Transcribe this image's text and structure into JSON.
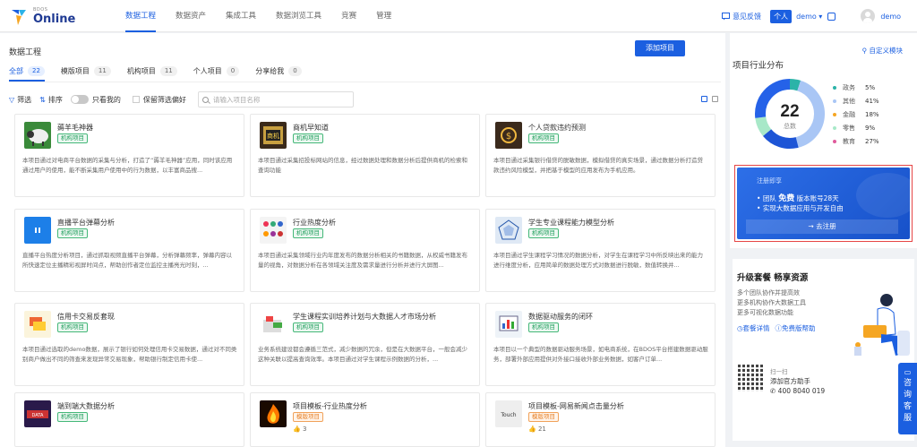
{
  "logo": {
    "small": "BDOS",
    "big": "Online"
  },
  "nav": [
    "数据工程",
    "数据资产",
    "集成工具",
    "数据浏览工具",
    "竞赛",
    "管理"
  ],
  "header": {
    "feedback": "意见反馈",
    "personal": "个人",
    "workspace": "demo ▾",
    "user": "demo"
  },
  "main": {
    "title": "数据工程",
    "add_button": "添加项目",
    "tabs": [
      {
        "label": "全部",
        "count": "22"
      },
      {
        "label": "模版项目",
        "count": "11"
      },
      {
        "label": "机构项目",
        "count": "11"
      },
      {
        "label": "个人项目",
        "count": "0"
      },
      {
        "label": "分享给我",
        "count": "0"
      }
    ],
    "filters": {
      "filter": "筛选",
      "sort": "排序",
      "only_mine": "只看我的",
      "keep": "保留筛选偏好",
      "search_placeholder": "请输入项目名称"
    }
  },
  "cards": [
    {
      "title": "薅羊毛神器",
      "tag": "机构项目",
      "desc": "本项目通过对电商平台数据的采集与分析，打造了“薅羊毛神器”应用，同时该应用通过用户的使用，能不断采集用户使用中的行为数据，以丰富商品搜..."
    },
    {
      "title": "商机早知道",
      "tag": "机构项目",
      "desc": "本项目通过采集招投标网站的信息，经过数据处理和数据分析后提供商机的检索和查询功能"
    },
    {
      "title": "个人贷款违约预测",
      "tag": "机构项目",
      "desc": "本项目通过采集银行借贷的脱敏数据，模拟借贷的真实场景，通过数据分析打造贷款违约风险模型，并把基于模型的应用发布为手机应用。"
    },
    {
      "title": "直播平台弹幕分析",
      "tag": "机构项目",
      "desc": "直播平台热度分析项目，通过抓取视频直播平台弹幕，分析弹幕频率，弹幕内容以所快速定位主播精彩视屏时间点，帮助创作者定位监控主播亮光时刻，..."
    },
    {
      "title": "行业热度分析",
      "tag": "机构项目",
      "desc": "本项目通过采集领域行业内年度发布的数据分析相关的书籍数据，从权威书籍发布量的视角，对数据分析在各领域关注度及需求量进行分析并进行大屏图..."
    },
    {
      "title": "学生专业课程能力模型分析",
      "tag": "机构项目",
      "desc": "本项目通过学生课程学习情况的数据分析，对学生在课程学习中所反映出来的能力进行维度分析，应用简单的数据处理方式对数据进行脱敏，数值转换并..."
    },
    {
      "title": "信用卡交易反套现",
      "tag": "机构项目",
      "desc": "本项目通过选取的demo数据，展示了银行如何处理信用卡交易数据，通过对不同类别商户做出不同的筛查来发现异常交易现象，帮助银行制定信用卡使..."
    },
    {
      "title": "学生课程实训培养计划与大数据人才市场分析",
      "tag": "机构项目",
      "desc": "业务系统建设都会遵循三范式，减少数据的冗余，但是在大数据平台，一般会减少这种关联以提高查询效率。本项目通过对学生课程示例数据的分析，..."
    },
    {
      "title": "数据驱动服务的闭环",
      "tag": "机构项目",
      "desc": "本项目以一个典型的数据驱动服务场景，如电商系统，在BDOS平台搭建数据驱动服务，部署外部应用提供对外接口接收外部业务数据，如客户订单..."
    },
    {
      "title": "端到端大数据分析",
      "tag": "机构项目",
      "desc": ""
    },
    {
      "title": "项目模板-行业热度分析",
      "tag": "模版项目",
      "likes": "3",
      "desc": ""
    },
    {
      "title": "项目模板-网易新闻点击量分析",
      "tag": "模版项目",
      "likes": "21",
      "desc": ""
    }
  ],
  "side": {
    "custom": "自定义模块",
    "dist_title": "项目行业分布",
    "total": "22",
    "total_label": "总数",
    "legend": [
      {
        "name": "政务",
        "pct": "5%",
        "color": "#2bb3a8",
        "value": 5
      },
      {
        "name": "其他",
        "pct": "41%",
        "color": "#a9c6f5",
        "value": 41
      },
      {
        "name": "金融",
        "pct": "18%",
        "color": "#1d55d6",
        "value": 18
      },
      {
        "name": "零售",
        "pct": "9%",
        "color": "#a8e8c8",
        "value": 9
      },
      {
        "name": "教育",
        "pct": "27%",
        "color": "#2562e8",
        "value": 27
      }
    ],
    "promo": {
      "t1": "注册即享",
      "t2a": "团队 ",
      "t2b": "免费",
      "t2c": " 版本账号28天",
      "t3": "实现大数据应用与开发自由",
      "go": "→  去注册"
    },
    "upgrade": {
      "title": "升级套餐 畅享资源",
      "lines": [
        "多个团队协作并提高效",
        "更多机构协作大数据工具",
        "更多可视化数据功能"
      ],
      "link1": "套餐详情",
      "link2": "免费版帮助",
      "scan": "扫一扫",
      "add": "添加官方助手",
      "phone": "400 8040 019"
    },
    "consult": [
      "咨",
      "询",
      "客",
      "服"
    ]
  }
}
